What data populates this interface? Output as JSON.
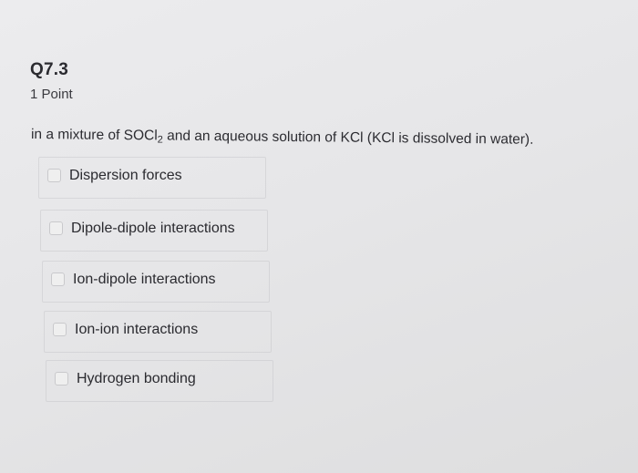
{
  "question": {
    "title": "Q7.3",
    "points": "1 Point",
    "prompt_pre": "in a mixture of SOCl",
    "prompt_sub": "2",
    "prompt_post": " and an aqueous solution of KCl (KCl is dissolved in water).",
    "options": [
      {
        "label": "Dispersion forces",
        "checked": false
      },
      {
        "label": "Dipole-dipole interactions",
        "checked": false
      },
      {
        "label": "Ion-dipole interactions",
        "checked": false
      },
      {
        "label": "Ion-ion interactions",
        "checked": false
      },
      {
        "label": "Hydrogen bonding",
        "checked": false
      }
    ]
  }
}
